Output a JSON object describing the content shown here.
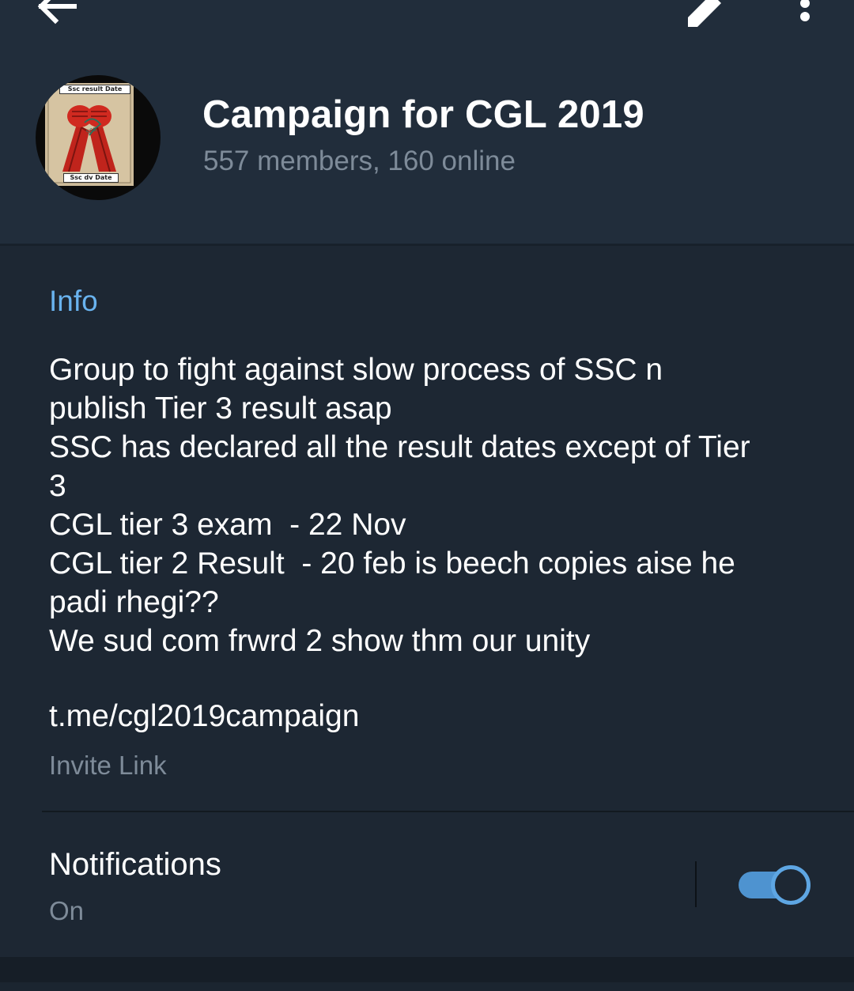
{
  "header": {
    "back_icon": "arrow-left-icon",
    "edit_icon": "pencil-icon",
    "more_icon": "more-vertical-icon",
    "title": "Campaign for CGL 2019",
    "status": "557 members, 160 online",
    "avatar": {
      "caption_top": "Ssc result Date",
      "caption_bottom": "Ssc dv Date"
    }
  },
  "info": {
    "section_title": "Info",
    "description_lines": [
      "Group to fight against slow process of SSC n",
      "publish Tier 3 result asap",
      "SSC has declared all the result dates except of Tier",
      "3",
      "CGL tier 3 exam  - 22 Nov",
      "CGL tier 2 Result  - 20 feb is beech copies aise he",
      "padi rhegi??",
      "We sud com frwrd 2 show thm our unity"
    ],
    "invite_link": "t.me/cgl2019campaign",
    "invite_label": "Invite Link"
  },
  "notifications": {
    "title": "Notifications",
    "value": "On",
    "enabled": true
  },
  "colors": {
    "background": "#1d2733",
    "header_background": "#212d3b",
    "accent": "#69b3ef",
    "toggle_on": "#4e93d0",
    "secondary_text": "#7e8b99"
  }
}
